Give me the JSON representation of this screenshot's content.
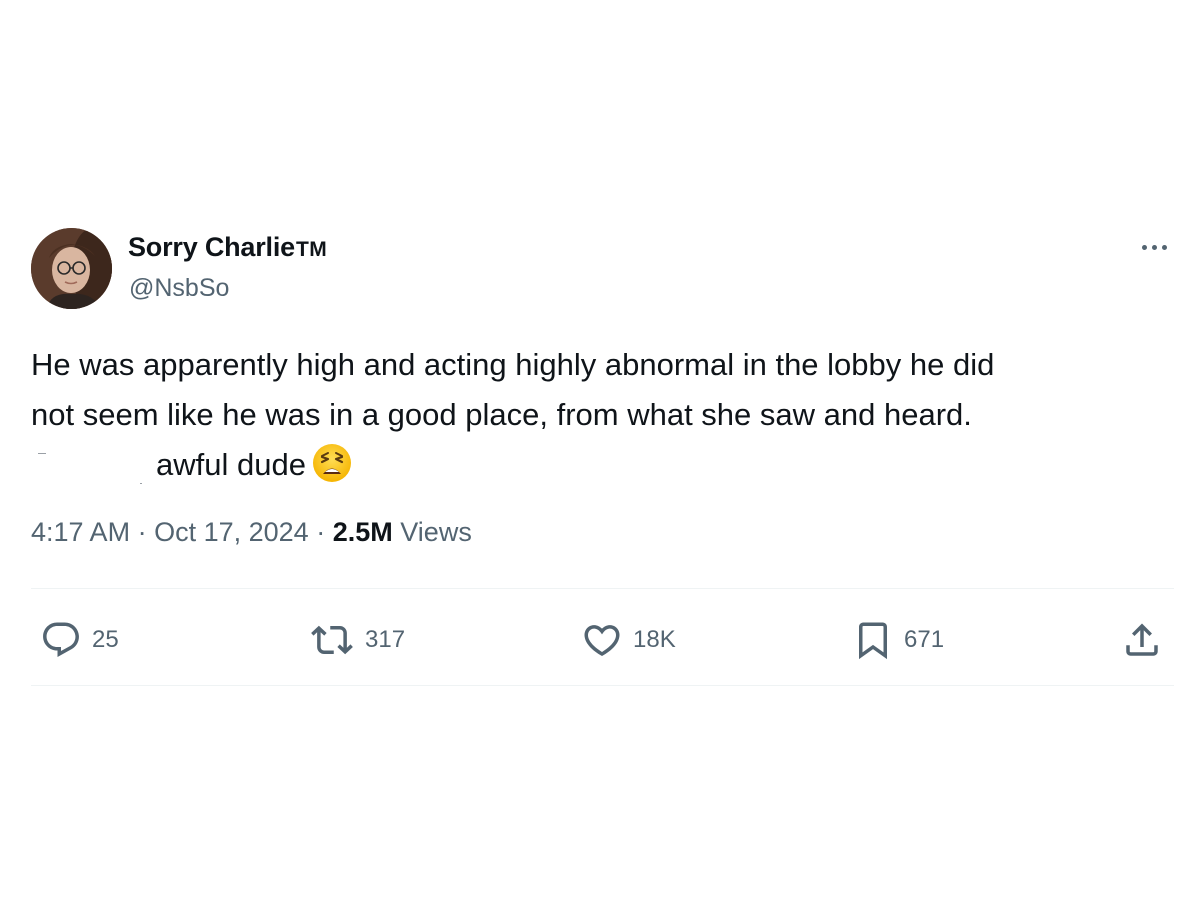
{
  "author": {
    "display_name": "Sorry Charlie",
    "badge": "TM",
    "handle": "@NsbSo"
  },
  "more_menu_icon": "more-horizontal-icon",
  "tweet": {
    "line1": "He was apparently high and acting highly abnormal in the lobby he did",
    "line2": "not seem like he was in a good place, from what she saw and heard.",
    "line3": "awful dude",
    "emoji": "weary-face"
  },
  "meta": {
    "time": "4:17 AM",
    "separator": "·",
    "date": "Oct 17, 2024",
    "views_count": "2.5M",
    "views_label": "Views"
  },
  "actions": {
    "reply": {
      "icon": "reply-icon",
      "count": "25"
    },
    "retweet": {
      "icon": "retweet-icon",
      "count": "317"
    },
    "like": {
      "icon": "heart-icon",
      "count": "18K"
    },
    "bookmark": {
      "icon": "bookmark-icon",
      "count": "671"
    },
    "share": {
      "icon": "share-icon"
    }
  },
  "colors": {
    "text_primary": "#0f1419",
    "text_secondary": "#536471",
    "divider": "#eff3f4",
    "background": "#ffffff"
  }
}
